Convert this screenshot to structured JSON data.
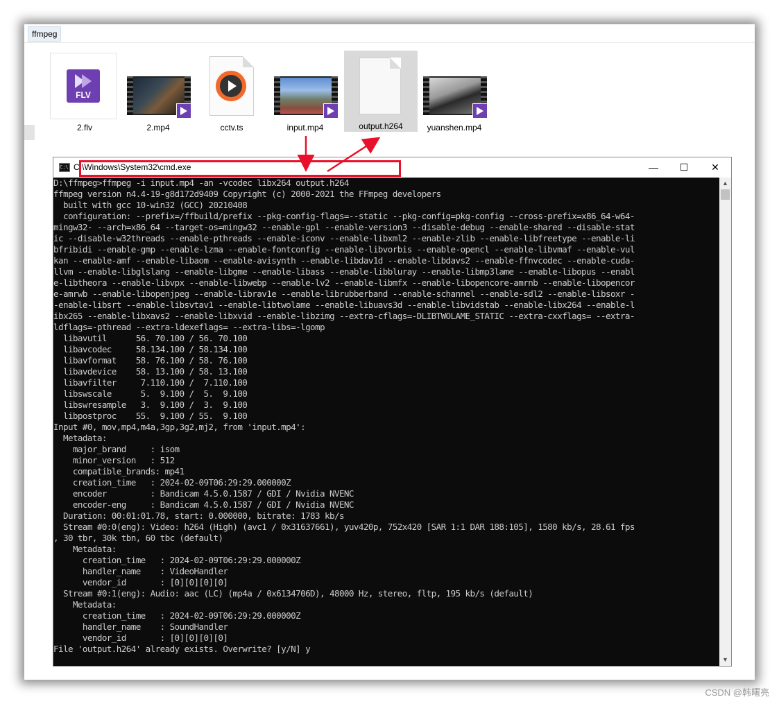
{
  "explorer": {
    "tab_label": "ffmpeg",
    "files": [
      {
        "name": "2.flv",
        "icon": "flv-file-icon",
        "badge_text": "FLV"
      },
      {
        "name": "2.mp4",
        "icon": "video-thumbnail"
      },
      {
        "name": "cctv.ts",
        "icon": "media-player-file-icon"
      },
      {
        "name": "input.mp4",
        "icon": "video-thumbnail"
      },
      {
        "name": "output.h264",
        "icon": "blank-file-icon",
        "selected": true
      },
      {
        "name": "yuanshen.mp4",
        "icon": "video-thumbnail"
      }
    ]
  },
  "cmd_window": {
    "title": "C:\\Windows\\System32\\cmd.exe",
    "icon_text": "C:\\",
    "minimize": "—",
    "maximize": "☐",
    "close": "✕"
  },
  "console": {
    "lines": [
      "D:\\ffmpeg>ffmpeg -i input.mp4 -an -vcodec libx264 output.h264",
      "ffmpeg version n4.4-19-g8d172d9409 Copyright (c) 2000-2021 the FFmpeg developers",
      "  built with gcc 10-win32 (GCC) 20210408",
      "  configuration: --prefix=/ffbuild/prefix --pkg-config-flags=--static --pkg-config=pkg-config --cross-prefix=x86_64-w64-",
      "mingw32- --arch=x86_64 --target-os=mingw32 --enable-gpl --enable-version3 --disable-debug --enable-shared --disable-stat",
      "ic --disable-w32threads --enable-pthreads --enable-iconv --enable-libxml2 --enable-zlib --enable-libfreetype --enable-li",
      "bfribidi --enable-gmp --enable-lzma --enable-fontconfig --enable-libvorbis --enable-opencl --enable-libvmaf --enable-vul",
      "kan --enable-amf --enable-libaom --enable-avisynth --enable-libdav1d --enable-libdavs2 --enable-ffnvcodec --enable-cuda-",
      "llvm --enable-libglslang --enable-libgme --enable-libass --enable-libbluray --enable-libmp3lame --enable-libopus --enabl",
      "e-libtheora --enable-libvpx --enable-libwebp --enable-lv2 --enable-libmfx --enable-libopencore-amrnb --enable-libopencor",
      "e-amrwb --enable-libopenjpeg --enable-librav1e --enable-librubberband --enable-schannel --enable-sdl2 --enable-libsoxr -",
      "-enable-libsrt --enable-libsvtav1 --enable-libtwolame --enable-libuavs3d --enable-libvidstab --enable-libx264 --enable-l",
      "ibx265 --enable-libxavs2 --enable-libxvid --enable-libzimg --extra-cflags=-DLIBTWOLAME_STATIC --extra-cxxflags= --extra-",
      "ldflags=-pthread --extra-ldexeflags= --extra-libs=-lgomp",
      "  libavutil      56. 70.100 / 56. 70.100",
      "  libavcodec     58.134.100 / 58.134.100",
      "  libavformat    58. 76.100 / 58. 76.100",
      "  libavdevice    58. 13.100 / 58. 13.100",
      "  libavfilter     7.110.100 /  7.110.100",
      "  libswscale      5.  9.100 /  5.  9.100",
      "  libswresample   3.  9.100 /  3.  9.100",
      "  libpostproc    55.  9.100 / 55.  9.100",
      "Input #0, mov,mp4,m4a,3gp,3g2,mj2, from 'input.mp4':",
      "  Metadata:",
      "    major_brand     : isom",
      "    minor_version   : 512",
      "    compatible_brands: mp41",
      "    creation_time   : 2024-02-09T06:29:29.000000Z",
      "    encoder         : Bandicam 4.5.0.1587 / GDI / Nvidia NVENC",
      "    encoder-eng     : Bandicam 4.5.0.1587 / GDI / Nvidia NVENC",
      "  Duration: 00:01:01.78, start: 0.000000, bitrate: 1783 kb/s",
      "  Stream #0:0(eng): Video: h264 (High) (avc1 / 0x31637661), yuv420p, 752x420 [SAR 1:1 DAR 188:105], 1580 kb/s, 28.61 fps",
      ", 30 tbr, 30k tbn, 60 tbc (default)",
      "    Metadata:",
      "      creation_time   : 2024-02-09T06:29:29.000000Z",
      "      handler_name    : VideoHandler",
      "      vendor_id       : [0][0][0][0]",
      "  Stream #0:1(eng): Audio: aac (LC) (mp4a / 0x6134706D), 48000 Hz, stereo, fltp, 195 kb/s (default)",
      "    Metadata:",
      "      creation_time   : 2024-02-09T06:29:29.000000Z",
      "      handler_name    : SoundHandler",
      "      vendor_id       : [0][0][0][0]",
      "File 'output.h264' already exists. Overwrite? [y/N] y"
    ]
  },
  "annotation": {
    "color": "#e8102a"
  },
  "watermark": "CSDN @韩曙亮"
}
